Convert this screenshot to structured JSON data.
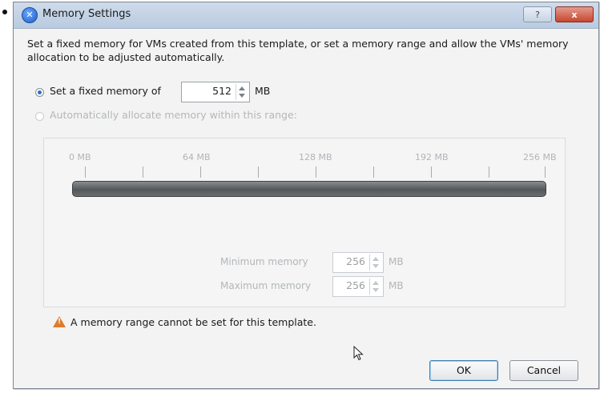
{
  "window": {
    "title": "Memory Settings",
    "help_label": "?",
    "close_label": "x"
  },
  "description": "Set a fixed memory for VMs created from this template, or set a memory range and allow the VMs' memory allocation to be adjusted automatically.",
  "fixed_option": {
    "label": "Set a fixed memory of",
    "value": "512",
    "unit": "MB",
    "selected": true
  },
  "auto_option": {
    "label": "Automatically allocate memory within this range:",
    "selected": false,
    "enabled": false
  },
  "range_slider": {
    "ticks": [
      "0 MB",
      "64 MB",
      "128 MB",
      "192 MB",
      "256 MB"
    ]
  },
  "minimum": {
    "label": "Minimum memory",
    "value": "256",
    "unit": "MB"
  },
  "maximum": {
    "label": "Maximum memory",
    "value": "256",
    "unit": "MB"
  },
  "warning": {
    "text": "A memory range cannot be set for this template."
  },
  "buttons": {
    "ok": "OK",
    "cancel": "Cancel"
  },
  "colors": {
    "accent": "#2f6fc4",
    "warning": "#e07a2c",
    "close": "#c6472f"
  }
}
